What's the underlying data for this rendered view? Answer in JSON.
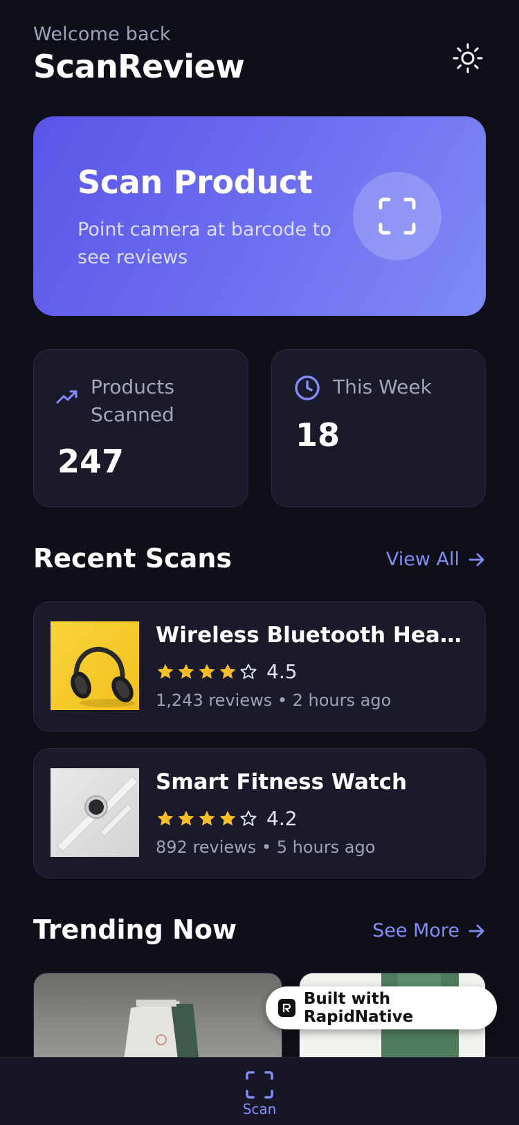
{
  "header": {
    "welcome": "Welcome back",
    "title": "ScanReview",
    "theme_icon": "sun-icon"
  },
  "scan_card": {
    "title": "Scan Product",
    "subtitle": "Point camera at barcode to see reviews",
    "icon": "scan-icon",
    "gradient": [
      "#5b55e8",
      "#7f8af6"
    ]
  },
  "stats": [
    {
      "label": "Products Scanned",
      "value": "247",
      "icon": "trending-up-icon"
    },
    {
      "label": "This Week",
      "value": "18",
      "icon": "clock-icon"
    }
  ],
  "recent": {
    "title": "Recent Scans",
    "link": "View All",
    "items": [
      {
        "name": "Wireless Bluetooth Headphones",
        "rating": "4.5",
        "stars": 4.5,
        "meta": "1,243 reviews • 2 hours ago",
        "image": "headphones-image"
      },
      {
        "name": "Smart Fitness Watch",
        "rating": "4.2",
        "stars": 4.2,
        "meta": "892 reviews • 5 hours ago",
        "image": "watch-image"
      }
    ]
  },
  "trending": {
    "title": "Trending Now",
    "link": "See More"
  },
  "badge": {
    "text": "Built with RapidNative"
  },
  "nav": {
    "scan_label": "Scan"
  },
  "colors": {
    "background": "#0f0f1a",
    "card": "#1a1a2b",
    "accent": "#818cf8",
    "star": "#fbbf24"
  }
}
